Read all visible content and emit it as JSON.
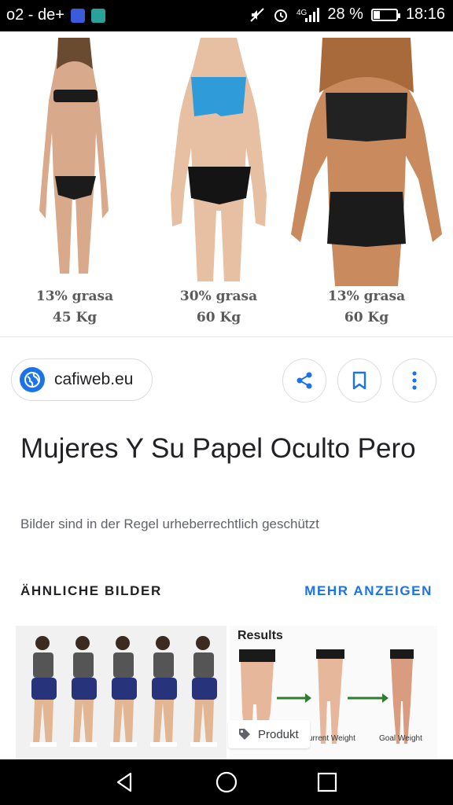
{
  "status_bar": {
    "carrier": "o2 - de+",
    "network": "4G",
    "battery_percent": "28 %",
    "battery_level": 0.28,
    "time": "18:16"
  },
  "hero": {
    "figures": [
      {
        "fat": "13% grasa",
        "weight": "45 Kg"
      },
      {
        "fat": "30% grasa",
        "weight": "60 Kg"
      },
      {
        "fat": "13% grasa",
        "weight": "60 Kg"
      }
    ]
  },
  "source": {
    "domain": "cafiweb.eu",
    "icon": "globe-icon"
  },
  "actions": {
    "share_icon": "share-icon",
    "bookmark_icon": "bookmark-icon",
    "more_icon": "more-vert-icon"
  },
  "title": "Mujeres Y Su Papel Oculto Pero",
  "copyright_note": "Bilder sind in der Regel urheberrechtlich geschützt",
  "related": {
    "heading": "ÄHNLICHE BILDER",
    "more_label": "MEHR ANZEIGEN",
    "thumb2": {
      "results_label": "Results",
      "label_current": "urrent Weight",
      "label_goal": "Goal Weight"
    },
    "product_chip": "Produkt"
  },
  "colors": {
    "accent": "#1a73e8",
    "text": "#202124",
    "muted": "#5f6368"
  }
}
